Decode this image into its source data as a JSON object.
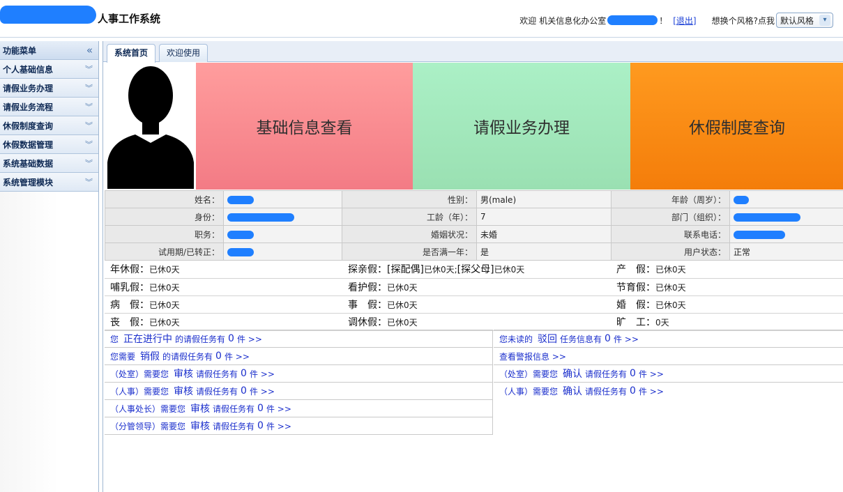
{
  "header": {
    "title": "人事工作系统",
    "welcome": "欢迎",
    "office": "机关信息化办公室",
    "exclaim": "！",
    "logout": "[退出]",
    "style_prompt": "想换个风格?点我",
    "style_value": "默认风格"
  },
  "sidebar": {
    "head": "功能菜单",
    "items": [
      {
        "label": "个人基础信息"
      },
      {
        "label": "请假业务办理"
      },
      {
        "label": "请假业务流程"
      },
      {
        "label": "休假制度查询"
      },
      {
        "label": "休假数据管理"
      },
      {
        "label": "系统基础数据"
      },
      {
        "label": "系统管理模块"
      }
    ]
  },
  "tabs": [
    "系统首页",
    "欢迎使用"
  ],
  "tiles": [
    "基础信息查看",
    "请假业务办理",
    "休假制度查询"
  ],
  "colors": {
    "tile_basic": "#f37b85",
    "tile_leave": "#9ae0b2",
    "tile_policy": "#f47d0a",
    "link": "#1a2ecc"
  },
  "info": {
    "name_label": "姓名：",
    "gender_label": "性别：",
    "gender": "男(male)",
    "age_label": "年龄（周岁）：",
    "identity_label": "身份：",
    "seniority_label": "工龄（年）：",
    "seniority": "7",
    "dept_label": "部门（组织）：",
    "duty_label": "职务：",
    "marital_label": "婚姻状况：",
    "marital": "未婚",
    "phone_label": "联系电话：",
    "probation_label": "试用期/已转正：",
    "over_year_label": "是否满一年：",
    "over_year": "是",
    "status_label": "用户状态：",
    "status": "正常"
  },
  "quota": {
    "annual": "年休假：",
    "annual_v": "已休0天",
    "family": "探亲假：",
    "family_v1": "[探配偶]",
    "family_v2": "已休0天;",
    "family_v3": "[探父母]",
    "family_v4": "已休0天",
    "maternity": "产　假：",
    "maternity_v": "已休0天",
    "nursing": "哺乳假：",
    "nursing_v": "已休0天",
    "care": "看护假：",
    "care_v": "已休0天",
    "planning": "节育假：",
    "planning_v": "已休0天",
    "sick": "病　假：",
    "sick_v": "已休0天",
    "personal": "事　假：",
    "personal_v": "已休0天",
    "marriage": "婚　假：",
    "marriage_v": "已休0天",
    "funeral": "丧　假：",
    "funeral_v": "已休0天",
    "comp": "调休假：",
    "comp_v": "已休0天",
    "absent": "旷　工：",
    "absent_v": "0天"
  },
  "tasks": {
    "left": [
      {
        "a": "您",
        "b": "正在进行中",
        "c": "的请假任务有",
        "n": "0",
        "d": "件 >>"
      },
      {
        "a": "您需要",
        "b": "销假",
        "c": "的请假任务有",
        "n": "0",
        "d": "件 >>"
      },
      {
        "a": "（处室）需要您",
        "b": "审核",
        "c": "请假任务有",
        "n": "0",
        "d": "件 >>"
      },
      {
        "a": "（人事）需要您",
        "b": "审核",
        "c": "请假任务有",
        "n": "0",
        "d": "件 >>"
      },
      {
        "a": "（人事处长）需要您",
        "b": "审核",
        "c": "请假任务有",
        "n": "0",
        "d": "件 >>"
      },
      {
        "a": "（分管领导）需要您",
        "b": "审核",
        "c": "请假任务有",
        "n": "0",
        "d": "件 >>"
      }
    ],
    "right": [
      {
        "a": "您未读的",
        "b": "驳回",
        "c": "任务信息有",
        "n": "0",
        "d": "件 >>"
      },
      {
        "a": "查看警报信息 >>",
        "b": "",
        "c": "",
        "n": "",
        "d": ""
      },
      {
        "a": "（处室）需要您",
        "b": "确认",
        "c": "请假任务有",
        "n": "0",
        "d": "件 >>"
      },
      {
        "a": "（人事）需要您",
        "b": "确认",
        "c": "请假任务有",
        "n": "0",
        "d": "件 >>"
      }
    ]
  }
}
